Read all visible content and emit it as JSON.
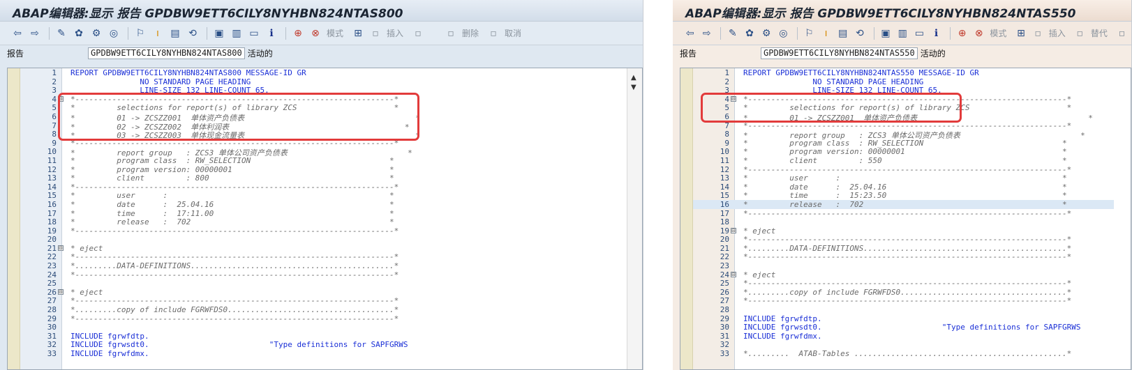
{
  "left": {
    "title": "ABAP编辑器:显示 报告 GPDBW9ETT6CILY8NYHBN824NTAS800",
    "program_label": "报告",
    "program_name": "GPDBW9ETT6CILY8NYHBN824NTAS800",
    "program_status": "活动的",
    "toolbar": {
      "mode_label": "模式",
      "insert_label": "插入",
      "delete_label": "删除",
      "cancel_label": "取消"
    },
    "lines": [
      {
        "n": "1",
        "text": "REPORT GPDBW9ETT6CILY8NYHBN824NTAS800 MESSAGE-ID GR",
        "type": "code"
      },
      {
        "n": "2",
        "text": "               NO STANDARD PAGE HEADING",
        "type": "code"
      },
      {
        "n": "3",
        "text": "               LINE-SIZE 132 LINE-COUNT 65.",
        "type": "code"
      },
      {
        "n": "4",
        "text": "*---------------------------------------------------------------------*",
        "type": "cmt",
        "fold": "⊟"
      },
      {
        "n": "5",
        "text": "*         selections for report(s) of library ZCS                     *",
        "type": "cmt"
      },
      {
        "n": "6",
        "text": "*         01 -> ZCSZZ001  单体资产负债表                                     *",
        "type": "cmt"
      },
      {
        "n": "7",
        "text": "*         02 -> ZCSZZ002  单体利润表                                      *",
        "type": "cmt"
      },
      {
        "n": "8",
        "text": "*         03 -> ZCSZZ003  单体现金流量表                                     *",
        "type": "cmt"
      },
      {
        "n": "9",
        "text": "*---------------------------------------------------------------------*",
        "type": "cmt"
      },
      {
        "n": "10",
        "text": "*         report group   : ZCS3 单体公司资产负债表                          *",
        "type": "cmt"
      },
      {
        "n": "11",
        "text": "*         program class  : RW_SELECTION                              *",
        "type": "cmt"
      },
      {
        "n": "12",
        "text": "*         program version: 00000001                                  *",
        "type": "cmt"
      },
      {
        "n": "13",
        "text": "*         client         : 800                                       *",
        "type": "cmt"
      },
      {
        "n": "14",
        "text": "*---------------------------------------------------------------------*",
        "type": "cmt"
      },
      {
        "n": "15",
        "text": "*         user      :                                                *",
        "type": "cmt"
      },
      {
        "n": "16",
        "text": "*         date      :  25.04.16                                      *",
        "type": "cmt"
      },
      {
        "n": "17",
        "text": "*         time      :  17:11.00                                      *",
        "type": "cmt"
      },
      {
        "n": "18",
        "text": "*         release   :  702                                           *",
        "type": "cmt"
      },
      {
        "n": "19",
        "text": "*---------------------------------------------------------------------*",
        "type": "cmt"
      },
      {
        "n": "20",
        "text": "",
        "type": "code"
      },
      {
        "n": "21",
        "text": "* eject",
        "type": "cmt",
        "fold": "⊟"
      },
      {
        "n": "22",
        "text": "*---------------------------------------------------------------------*",
        "type": "cmt"
      },
      {
        "n": "23",
        "text": "*.........DATA-DEFINITIONS............................................*",
        "type": "cmt"
      },
      {
        "n": "24",
        "text": "*---------------------------------------------------------------------*",
        "type": "cmt"
      },
      {
        "n": "25",
        "text": "",
        "type": "code"
      },
      {
        "n": "26",
        "text": "* eject",
        "type": "cmt",
        "fold": "⊟"
      },
      {
        "n": "27",
        "text": "*---------------------------------------------------------------------*",
        "type": "cmt"
      },
      {
        "n": "28",
        "text": "*.........copy of include FGRWFDS0....................................*",
        "type": "cmt"
      },
      {
        "n": "29",
        "text": "*---------------------------------------------------------------------*",
        "type": "cmt"
      },
      {
        "n": "30",
        "text": "",
        "type": "code"
      },
      {
        "n": "31",
        "text": "INCLUDE fgrwfdtp.",
        "type": "code"
      },
      {
        "n": "32",
        "text": "INCLUDE fgrwsdt0.                          \"Type definitions for SAPFGRWS",
        "type": "code"
      },
      {
        "n": "33",
        "text": "INCLUDE fgrwfdmx.",
        "type": "code"
      }
    ]
  },
  "right": {
    "title": "ABAP编辑器:显示 报告 GPDBW9ETT6CILY8NYHBN824NTAS550",
    "program_label": "报告",
    "program_name": "GPDBW9ETT6CILY8NYHBN824NTAS550",
    "program_status": "活动的",
    "toolbar": {
      "mode_label": "模式",
      "insert_label": "插入",
      "replace_label": "替代"
    },
    "lines": [
      {
        "n": "1",
        "text": "REPORT GPDBW9ETT6CILY8NYHBN824NTAS550 MESSAGE-ID GR",
        "type": "code"
      },
      {
        "n": "2",
        "text": "               NO STANDARD PAGE HEADING",
        "type": "code"
      },
      {
        "n": "3",
        "text": "               LINE-SIZE 132 LINE-COUNT 65.",
        "type": "code"
      },
      {
        "n": "4",
        "text": "*---------------------------------------------------------------------*",
        "type": "cmt",
        "fold": "⊟"
      },
      {
        "n": "5",
        "text": "*         selections for report(s) of library ZCS                     *",
        "type": "cmt"
      },
      {
        "n": "6",
        "text": "*         01 -> ZCSZZ001  单体资产负债表                                     *",
        "type": "cmt"
      },
      {
        "n": "7",
        "text": "*---------------------------------------------------------------------*",
        "type": "cmt"
      },
      {
        "n": "8",
        "text": "*         report group   : ZCS3 单体公司资产负债表                          *",
        "type": "cmt"
      },
      {
        "n": "9",
        "text": "*         program class  : RW_SELECTION                              *",
        "type": "cmt"
      },
      {
        "n": "10",
        "text": "*         program version: 00000001                                  *",
        "type": "cmt"
      },
      {
        "n": "11",
        "text": "*         client         : 550                                       *",
        "type": "cmt"
      },
      {
        "n": "12",
        "text": "*---------------------------------------------------------------------*",
        "type": "cmt"
      },
      {
        "n": "13",
        "text": "*         user      :                                                *",
        "type": "cmt"
      },
      {
        "n": "14",
        "text": "*         date      :  25.04.16                                      *",
        "type": "cmt"
      },
      {
        "n": "15",
        "text": "*         time      :  15:23.50                                      *",
        "type": "cmt"
      },
      {
        "n": "16",
        "text": "*         release   :  702                                           *",
        "type": "cmt",
        "hl": true
      },
      {
        "n": "17",
        "text": "*---------------------------------------------------------------------*",
        "type": "cmt"
      },
      {
        "n": "18",
        "text": "",
        "type": "code"
      },
      {
        "n": "19",
        "text": "* eject",
        "type": "cmt",
        "fold": "⊟"
      },
      {
        "n": "20",
        "text": "*---------------------------------------------------------------------*",
        "type": "cmt"
      },
      {
        "n": "21",
        "text": "*.........DATA-DEFINITIONS............................................*",
        "type": "cmt"
      },
      {
        "n": "22",
        "text": "*---------------------------------------------------------------------*",
        "type": "cmt"
      },
      {
        "n": "23",
        "text": "",
        "type": "code"
      },
      {
        "n": "24",
        "text": "* eject",
        "type": "cmt",
        "fold": "⊟"
      },
      {
        "n": "25",
        "text": "*---------------------------------------------------------------------*",
        "type": "cmt"
      },
      {
        "n": "26",
        "text": "*.........copy of include FGRWFDS0....................................*",
        "type": "cmt"
      },
      {
        "n": "27",
        "text": "*---------------------------------------------------------------------*",
        "type": "cmt"
      },
      {
        "n": "28",
        "text": "",
        "type": "code"
      },
      {
        "n": "29",
        "text": "INCLUDE fgrwfdtp.",
        "type": "code"
      },
      {
        "n": "30",
        "text": "INCLUDE fgrwsdt0.                          \"Type definitions for SAPFGRWS",
        "type": "code"
      },
      {
        "n": "31",
        "text": "INCLUDE fgrwfdmx.",
        "type": "code"
      },
      {
        "n": "32",
        "text": "",
        "type": "code"
      },
      {
        "n": "33",
        "text": "*.........  ATAB-Tables ..............................................*",
        "type": "cmt"
      }
    ]
  }
}
